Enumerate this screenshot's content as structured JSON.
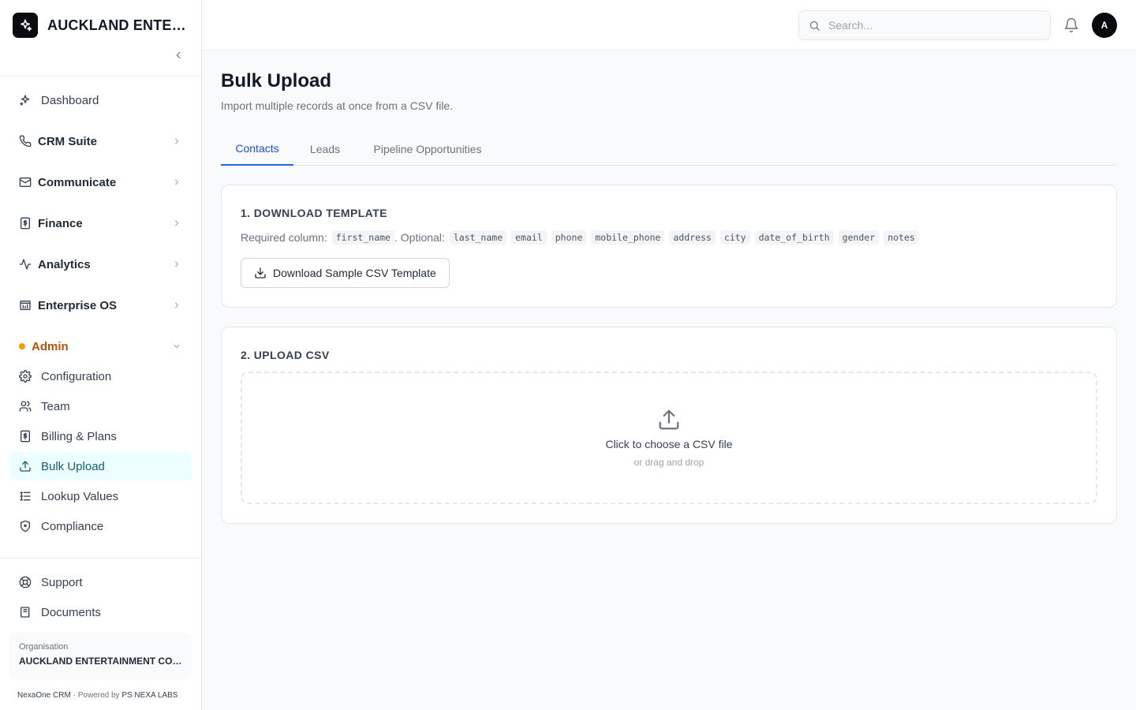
{
  "sidebar": {
    "brand": "AUCKLAND ENTERTAINMENT COMPANY",
    "groups": [
      {
        "label": "Dashboard",
        "icon": "sparkles-icon"
      },
      {
        "label": "CRM Suite",
        "icon": "phone-icon"
      },
      {
        "label": "Communicate",
        "icon": "mail-icon"
      },
      {
        "label": "Finance",
        "icon": "receipt-icon"
      },
      {
        "label": "Analytics",
        "icon": "activity-icon"
      },
      {
        "label": "Enterprise OS",
        "icon": "building-icon"
      }
    ],
    "admin": {
      "label": "Admin",
      "items": [
        {
          "label": "Configuration",
          "icon": "gear-icon"
        },
        {
          "label": "Team",
          "icon": "users-icon"
        },
        {
          "label": "Billing & Plans",
          "icon": "receipt-icon"
        },
        {
          "label": "Bulk Upload",
          "icon": "upload-icon"
        },
        {
          "label": "Lookup Values",
          "icon": "list-icon"
        },
        {
          "label": "Compliance",
          "icon": "shield-icon"
        }
      ]
    },
    "bottom": [
      {
        "label": "Support",
        "icon": "lifebuoy-icon"
      },
      {
        "label": "Documents",
        "icon": "book-icon"
      }
    ],
    "org": {
      "label": "Organisation",
      "name": "AUCKLAND ENTERTAINMENT COMPANY"
    },
    "footer": {
      "product": "NexaOne CRM",
      "sep": "·",
      "powered": "Powered by",
      "company": "PS NEXA LABS"
    }
  },
  "header": {
    "search_placeholder": "Search...",
    "avatar": "A"
  },
  "main": {
    "title": "Bulk Upload",
    "subtitle": "Import multiple records at once from a CSV file.",
    "tabs": [
      {
        "label": "Contacts",
        "active": true
      },
      {
        "label": "Leads",
        "active": false
      },
      {
        "label": "Pipeline Opportunities",
        "active": false
      }
    ],
    "step1": {
      "title": "1. DOWNLOAD TEMPLATE",
      "required_label": "Required column:",
      "required": "first_name",
      "optional_label": ". Optional:",
      "optional": [
        "last_name",
        "email",
        "phone",
        "mobile_phone",
        "address",
        "city",
        "date_of_birth",
        "gender",
        "notes"
      ],
      "button": "Download Sample CSV Template"
    },
    "step2": {
      "title": "2. UPLOAD CSV",
      "main_text": "Click to choose a CSV file",
      "sub_text": "or drag and drop"
    }
  },
  "colors": {
    "accent": "#2563eb",
    "active_bg": "#ecfeff",
    "active_text": "#155e75",
    "admin": "#b45309",
    "admin_dot": "#f59e0b"
  }
}
